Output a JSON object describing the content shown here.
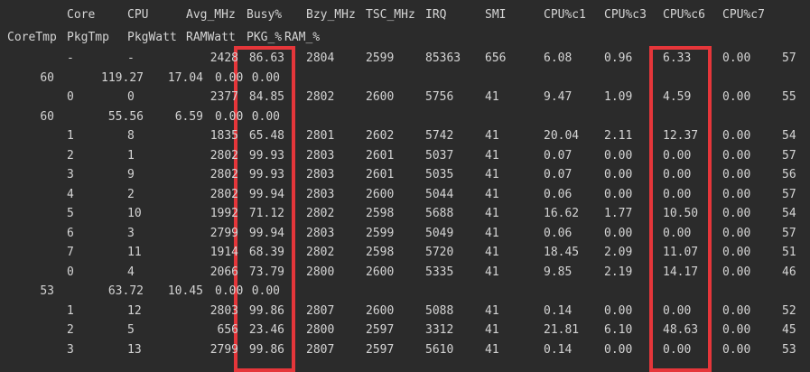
{
  "header": {
    "row1": [
      "Core",
      "CPU",
      "Avg_MHz",
      "Busy%",
      "Bzy_MHz",
      "TSC_MHz",
      "IRQ",
      "SMI",
      "CPU%c1",
      "CPU%c3",
      "CPU%c6",
      "CPU%c7"
    ],
    "row2": [
      "CoreTmp",
      "PkgTmp",
      "PkgWatt",
      "RAMWatt",
      "PKG_%",
      "RAM_%"
    ]
  },
  "rows": [
    {
      "kind": "main",
      "cells": [
        "-",
        "-",
        "2428",
        "86.63",
        "2804",
        "2599",
        "85363",
        "656",
        "6.08",
        "0.96",
        "6.33",
        "0.00",
        "57"
      ]
    },
    {
      "kind": "pkg",
      "cells": [
        "60",
        "119.27",
        "17.04",
        "0.00",
        "0.00"
      ]
    },
    {
      "kind": "main",
      "cells": [
        "0",
        "0",
        "2377",
        "84.85",
        "2802",
        "2600",
        "5756",
        "41",
        "9.47",
        "1.09",
        "4.59",
        "0.00",
        "55"
      ]
    },
    {
      "kind": "pkg",
      "cells": [
        "60",
        "55.56",
        "6.59",
        "0.00",
        "0.00"
      ]
    },
    {
      "kind": "main",
      "cells": [
        "1",
        "8",
        "1835",
        "65.48",
        "2801",
        "2602",
        "5742",
        "41",
        "20.04",
        "2.11",
        "12.37",
        "0.00",
        "54"
      ]
    },
    {
      "kind": "main",
      "cells": [
        "2",
        "1",
        "2802",
        "99.93",
        "2803",
        "2601",
        "5037",
        "41",
        "0.07",
        "0.00",
        "0.00",
        "0.00",
        "57"
      ]
    },
    {
      "kind": "main",
      "cells": [
        "3",
        "9",
        "2802",
        "99.93",
        "2803",
        "2601",
        "5035",
        "41",
        "0.07",
        "0.00",
        "0.00",
        "0.00",
        "56"
      ]
    },
    {
      "kind": "main",
      "cells": [
        "4",
        "2",
        "2802",
        "99.94",
        "2803",
        "2600",
        "5044",
        "41",
        "0.06",
        "0.00",
        "0.00",
        "0.00",
        "57"
      ]
    },
    {
      "kind": "main",
      "cells": [
        "5",
        "10",
        "1992",
        "71.12",
        "2802",
        "2598",
        "5688",
        "41",
        "16.62",
        "1.77",
        "10.50",
        "0.00",
        "54"
      ]
    },
    {
      "kind": "main",
      "cells": [
        "6",
        "3",
        "2799",
        "99.94",
        "2803",
        "2599",
        "5049",
        "41",
        "0.06",
        "0.00",
        "0.00",
        "0.00",
        "57"
      ]
    },
    {
      "kind": "main",
      "cells": [
        "7",
        "11",
        "1914",
        "68.39",
        "2802",
        "2598",
        "5720",
        "41",
        "18.45",
        "2.09",
        "11.07",
        "0.00",
        "51"
      ]
    },
    {
      "kind": "main",
      "cells": [
        "0",
        "4",
        "2066",
        "73.79",
        "2800",
        "2600",
        "5335",
        "41",
        "9.85",
        "2.19",
        "14.17",
        "0.00",
        "46"
      ]
    },
    {
      "kind": "pkg",
      "cells": [
        "53",
        "63.72",
        "10.45",
        "0.00",
        "0.00"
      ]
    },
    {
      "kind": "main",
      "cells": [
        "1",
        "12",
        "2803",
        "99.86",
        "2807",
        "2600",
        "5088",
        "41",
        "0.14",
        "0.00",
        "0.00",
        "0.00",
        "52"
      ]
    },
    {
      "kind": "main",
      "cells": [
        "2",
        "5",
        "656",
        "23.46",
        "2800",
        "2597",
        "3312",
        "41",
        "21.81",
        "6.10",
        "48.63",
        "0.00",
        "45"
      ]
    },
    {
      "kind": "main",
      "cells": [
        "3",
        "13",
        "2799",
        "99.86",
        "2807",
        "2597",
        "5610",
        "41",
        "0.14",
        "0.00",
        "0.00",
        "0.00",
        "53"
      ]
    }
  ],
  "highlights": [
    "Busy%",
    "CPU%c6"
  ],
  "colors": {
    "background": "#2b2b2b",
    "text": "#d4d4d4",
    "highlight": "#e5363a"
  }
}
